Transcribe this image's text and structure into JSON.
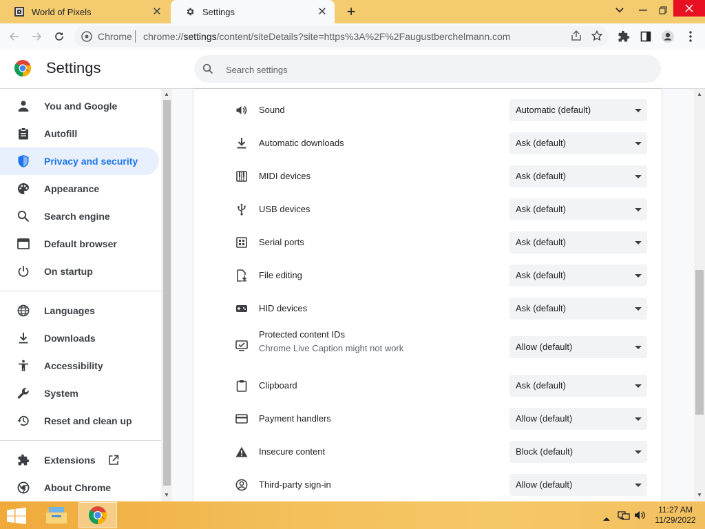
{
  "tabs": [
    {
      "title": "World of Pixels",
      "active": false
    },
    {
      "title": "Settings",
      "active": true
    }
  ],
  "omnibox": {
    "site_label": "Chrome",
    "url_prefix": "chrome://",
    "url_host": "settings",
    "url_path": "/content/siteDetails?site=https%3A%2F%2Faugustberchelmann.com"
  },
  "header": {
    "title": "Settings",
    "search_placeholder": "Search settings"
  },
  "sidebar": {
    "items": [
      {
        "label": "You and Google",
        "icon": "person-icon"
      },
      {
        "label": "Autofill",
        "icon": "clipboard-icon"
      },
      {
        "label": "Privacy and security",
        "icon": "shield-icon",
        "selected": true
      },
      {
        "label": "Appearance",
        "icon": "palette-icon"
      },
      {
        "label": "Search engine",
        "icon": "search-icon"
      },
      {
        "label": "Default browser",
        "icon": "browser-icon"
      },
      {
        "label": "On startup",
        "icon": "power-icon"
      },
      {
        "label": "Languages",
        "icon": "globe-icon"
      },
      {
        "label": "Downloads",
        "icon": "download-icon"
      },
      {
        "label": "Accessibility",
        "icon": "accessibility-icon"
      },
      {
        "label": "System",
        "icon": "wrench-icon"
      },
      {
        "label": "Reset and clean up",
        "icon": "history-icon"
      },
      {
        "label": "Extensions",
        "icon": "puzzle-icon"
      },
      {
        "label": "About Chrome",
        "icon": "chrome-icon"
      }
    ]
  },
  "permissions": [
    {
      "label": "Sound",
      "value": "Automatic (default)",
      "icon": "speaker-icon"
    },
    {
      "label": "Automatic downloads",
      "value": "Ask (default)",
      "icon": "download-icon"
    },
    {
      "label": "MIDI devices",
      "value": "Ask (default)",
      "icon": "piano-icon"
    },
    {
      "label": "USB devices",
      "value": "Ask (default)",
      "icon": "usb-icon"
    },
    {
      "label": "Serial ports",
      "value": "Ask (default)",
      "icon": "serial-port-icon"
    },
    {
      "label": "File editing",
      "value": "Ask (default)",
      "icon": "file-edit-icon"
    },
    {
      "label": "HID devices",
      "value": "Ask (default)",
      "icon": "gamepad-icon"
    },
    {
      "label": "Protected content IDs",
      "sublabel": "Chrome Live Caption might not work",
      "value": "Allow (default)",
      "icon": "protected-content-icon"
    },
    {
      "label": "Clipboard",
      "value": "Ask (default)",
      "icon": "clipboard-icon"
    },
    {
      "label": "Payment handlers",
      "value": "Allow (default)",
      "icon": "credit-card-icon"
    },
    {
      "label": "Insecure content",
      "value": "Block (default)",
      "icon": "warning-icon"
    },
    {
      "label": "Third-party sign-in",
      "value": "Allow (default)",
      "icon": "account-circle-icon"
    }
  ],
  "taskbar": {
    "time": "11:27 AM",
    "date": "11/29/2022"
  },
  "colors": {
    "accent": "#1a73e8",
    "selected_bg": "#e8f0fe",
    "tabstrip": "#f4cb6e",
    "taskbar": "#f3bf5a"
  }
}
